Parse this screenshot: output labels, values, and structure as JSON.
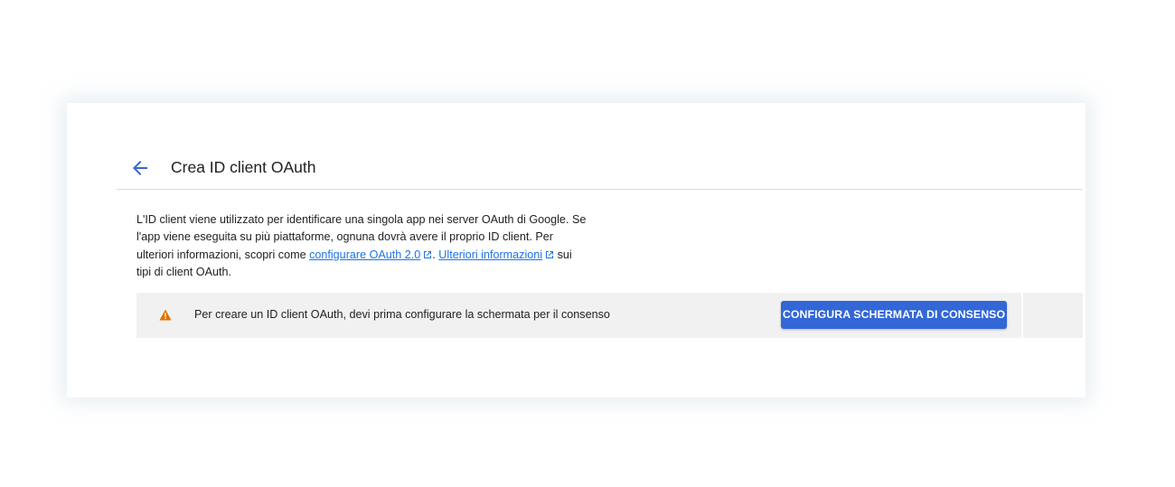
{
  "header": {
    "back_icon": "arrow-back-icon",
    "title": "Crea ID client OAuth"
  },
  "description": {
    "text_1": "L'ID client viene utilizzato per identificare una singola app nei server OAuth di Google. Se l'app viene eseguita su più piattaforme, ognuna dovrà avere il proprio ID client. Per ulteriori informazioni, scopri come ",
    "link_1": "configurare OAuth 2.0",
    "text_2": ". ",
    "link_2": "Ulteriori informazioni",
    "text_3": " sui tipi di client OAuth."
  },
  "banner": {
    "icon": "warning-icon",
    "message": "Per creare un ID client OAuth, devi prima configurare la schermata per il consenso",
    "button_label": "CONFIGURA SCHERMATA DI CONSENSO"
  },
  "colors": {
    "accent": "#3367d6",
    "link": "#1a73e8",
    "warning": "#e37400",
    "banner_bg": "#f1f1f1"
  }
}
